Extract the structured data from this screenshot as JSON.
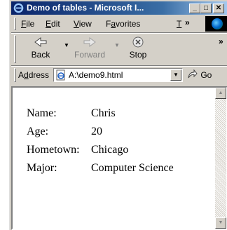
{
  "window": {
    "title": "Demo of tables - Microsoft I...",
    "controls": {
      "minimize": "_",
      "maximize": "□",
      "close": "✕"
    }
  },
  "menu": {
    "items": [
      {
        "pre": "",
        "key": "F",
        "post": "ile"
      },
      {
        "pre": "",
        "key": "E",
        "post": "dit"
      },
      {
        "pre": "",
        "key": "V",
        "post": "iew"
      },
      {
        "pre": "F",
        "key": "a",
        "post": "vorites"
      },
      {
        "pre": "",
        "key": "T",
        "post": ""
      }
    ],
    "overflow": "»"
  },
  "toolbar": {
    "back_label": "Back",
    "forward_label": "Forward",
    "stop_label": "Stop",
    "overflow": "»",
    "icons": {
      "back": "back-arrow-icon",
      "forward": "forward-arrow-icon",
      "stop": "stop-icon"
    }
  },
  "address": {
    "label_pre": "A",
    "label_key": "d",
    "label_post": "dress",
    "value": "A:\\demo9.html",
    "go_label": "Go",
    "icons": {
      "page": "ie-page-icon",
      "go": "go-arrow-icon"
    }
  },
  "content": {
    "rows": [
      {
        "key": "Name:",
        "value": "Chris"
      },
      {
        "key": "Age:",
        "value": "20"
      },
      {
        "key": "Hometown:",
        "value": "Chicago"
      },
      {
        "key": "Major:",
        "value": "Computer Science"
      }
    ]
  },
  "colors": {
    "titlebar_start": "#0a246a",
    "titlebar_end": "#a6caf0",
    "chrome": "#d4d0c8"
  }
}
